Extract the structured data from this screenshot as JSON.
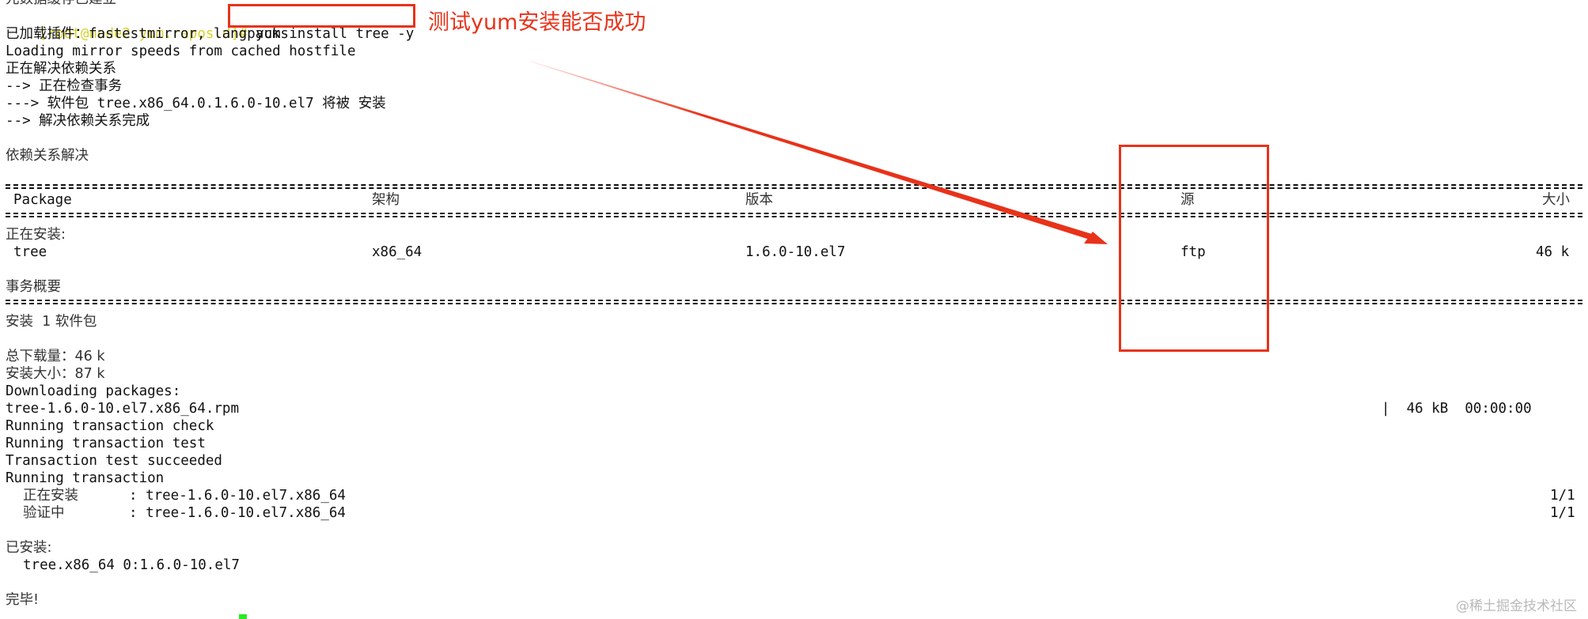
{
  "terminal": {
    "cut_top_line": "元数据缓存已建立",
    "prompt": "[root@node2 yum.repos.d]#",
    "command": "yum install tree -y",
    "lines": [
      "已加载插件：fastestmirror, langpacks",
      "Loading mirror speeds from cached hostfile",
      "正在解决依赖关系",
      "--> 正在检查事务",
      "---> 软件包 tree.x86_64.0.1.6.0-10.el7 将被 安装",
      "--> 解决依赖关系完成",
      "依赖关系解决"
    ],
    "table": {
      "headers": [
        "Package",
        "架构",
        "版本",
        "源",
        "大小"
      ],
      "section_label": "正在安装:",
      "rows": [
        {
          "package": "tree",
          "arch": "x86_64",
          "version": "1.6.0-10.el7",
          "repo": "ftp",
          "size": "46 k"
        }
      ]
    },
    "summary": {
      "title": "事务概要",
      "install_count": "安装  1 软件包",
      "total_download": "总下载量：46 k",
      "install_size": "安装大小：87 k"
    },
    "download": {
      "header": "Downloading packages:",
      "file": "tree-1.6.0-10.el7.x86_64.rpm",
      "progress": "|  46 kB  00:00:00"
    },
    "transaction": [
      "Running transaction check",
      "Running transaction test",
      "Transaction test succeeded",
      "Running transaction"
    ],
    "steps": [
      {
        "label": "正在安装",
        "pkg": ": tree-1.6.0-10.el7.x86_64",
        "count": "1/1"
      },
      {
        "label": "验证中",
        "pkg": ": tree-1.6.0-10.el7.x86_64",
        "count": "1/1"
      }
    ],
    "installed_label": "已安装:",
    "installed_pkg": "tree.x86_64 0:1.6.0-10.el7",
    "done": "完毕!"
  },
  "annotation": {
    "text": "测试yum安装能否成功",
    "color": "#e8321a"
  },
  "watermark": "@稀土掘金技术社区",
  "colors": {
    "prompt": "#d6d22a",
    "cursor": "#22ee22"
  }
}
